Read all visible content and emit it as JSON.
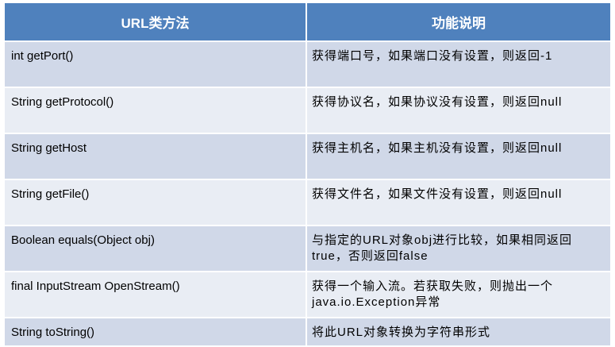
{
  "table": {
    "headers": [
      "URL类方法",
      "功能说明"
    ],
    "rows": [
      {
        "method": "int getPort()",
        "desc": "获得端口号，如果端口没有设置，则返回-1"
      },
      {
        "method": "String getProtocol()",
        "desc": "获得协议名，如果协议没有设置，则返回null"
      },
      {
        "method": "String getHost",
        "desc": "获得主机名，如果主机没有设置，则返回null"
      },
      {
        "method": "String getFile()",
        "desc": "获得文件名，如果文件没有设置，则返回null"
      },
      {
        "method": "Boolean equals(Object obj)",
        "desc": "与指定的URL对象obj进行比较，如果相同返回true，否则返回false"
      },
      {
        "method": "final InputStream OpenStream()",
        "desc": "获得一个输入流。若获取失败，则抛出一个java.io.Exception异常"
      },
      {
        "method": "String toString()",
        "desc": "将此URL对象转换为字符串形式"
      }
    ]
  },
  "colors": {
    "header": "#4f81bd",
    "row_dark": "#d0d8e8",
    "row_light": "#e9edf4"
  }
}
